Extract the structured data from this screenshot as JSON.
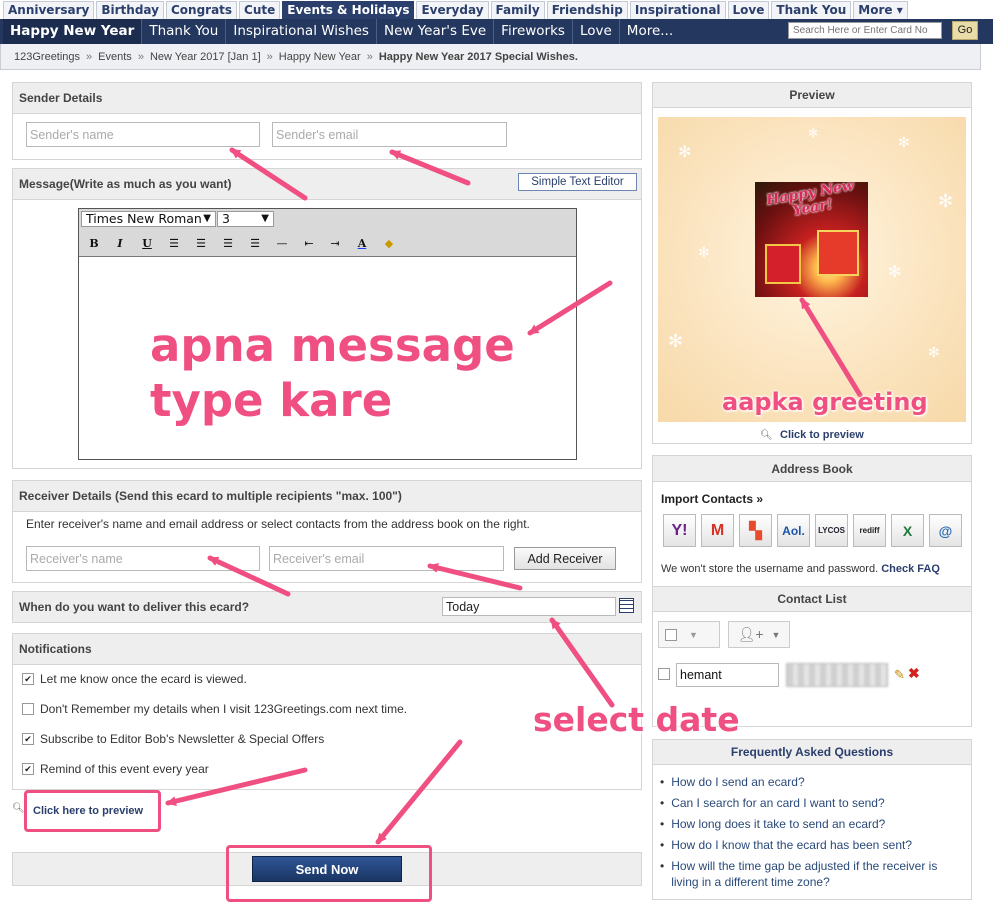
{
  "top_tabs": [
    "Anniversary",
    "Birthday",
    "Congrats",
    "Cute",
    "Events & Holidays",
    "Everyday",
    "Family",
    "Friendship",
    "Inspirational",
    "Love",
    "Thank You",
    "More"
  ],
  "sub_tabs": [
    "Happy New Year",
    "Thank You",
    "Inspirational Wishes",
    "New Year's Eve",
    "Fireworks",
    "Love",
    "More..."
  ],
  "search": {
    "placeholder": "Search Here or Enter Card No",
    "button": "Go"
  },
  "breadcrumb": [
    "123Greetings",
    "Events",
    "New Year 2017 [Jan 1]",
    "Happy New Year",
    "Happy New Year 2017 Special Wishes."
  ],
  "sender": {
    "title": "Sender Details",
    "name_placeholder": "Sender's name",
    "email_placeholder": "Sender's email"
  },
  "message": {
    "title": "Message(Write as much as you want)",
    "editor_toggle": "Simple Text Editor",
    "font": "Times New Roman",
    "size": "3"
  },
  "receiver": {
    "title": "Receiver Details (Send this ecard to multiple recipients \"max. 100\")",
    "instructions": "Enter receiver's name and email address or select contacts from the address book on the right.",
    "name_placeholder": "Receiver's name",
    "email_placeholder": "Receiver's email",
    "add_button": "Add Receiver"
  },
  "delivery": {
    "label": "When do you want to deliver this ecard?",
    "value": "Today"
  },
  "notifications": {
    "title": "Notifications",
    "items": [
      {
        "label": "Let me know once the ecard is viewed.",
        "checked": true
      },
      {
        "label": "Don't Remember my details when I visit 123Greetings.com next time.",
        "checked": false
      },
      {
        "label": "Subscribe to Editor Bob's Newsletter & Special Offers",
        "checked": true
      },
      {
        "label": "Remind of this event every year",
        "checked": true
      }
    ]
  },
  "preview_link": "Click here to preview",
  "send_button": "Send Now",
  "preview_panel": {
    "title": "Preview",
    "card_text": "Happy New Year!",
    "link": "Click to preview"
  },
  "address_book": {
    "title": "Address Book",
    "import_label": "Import Contacts »",
    "services": [
      "Y!",
      "Gmail",
      "Windows",
      "Aol.",
      "Lycos",
      "rediff",
      "Excel",
      "Email"
    ],
    "note": "We won't store the username and password.",
    "note_link": "Check FAQ"
  },
  "contact_list": {
    "title": "Contact List",
    "contact_name": "hemant"
  },
  "faq": {
    "title": "Frequently Asked Questions",
    "items": [
      "How do I send an ecard?",
      "Can I search for an card I want to send?",
      "How long does it take to send an ecard?",
      "How do I know that the ecard has been sent?",
      "How will the time gap be adjusted if the receiver is living in a different time zone?"
    ]
  },
  "annotations": {
    "message": "apna message\ntype kare",
    "greeting": "aapka greeting",
    "date": "select date"
  },
  "colors": {
    "nav_dark": "#23375f",
    "annotation": "#f04f82",
    "send_button": "#1f3f73"
  }
}
